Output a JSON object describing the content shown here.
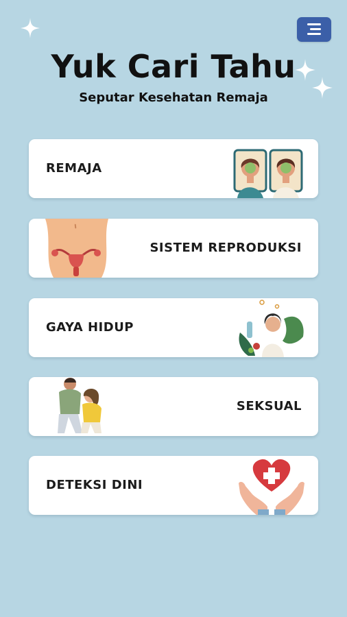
{
  "header": {
    "title": "Yuk Cari Tahu",
    "subtitle": "Seputar Kesehatan Remaja"
  },
  "menu_button": {
    "icon": "menu-icon"
  },
  "cards": [
    {
      "label": "REMAJA",
      "icon": "teenagers-illustration"
    },
    {
      "label": "SISTEM REPRODUKSI",
      "icon": "reproductive-system-illustration"
    },
    {
      "label": "GAYA HIDUP",
      "icon": "healthy-lifestyle-illustration"
    },
    {
      "label": "SEKSUAL",
      "icon": "couple-illustration"
    },
    {
      "label": "DETEKSI DINI",
      "icon": "heart-hands-illustration"
    }
  ],
  "colors": {
    "background": "#b7d6e3",
    "menu_button": "#3b5fa8",
    "card": "#ffffff",
    "text": "#111111"
  }
}
